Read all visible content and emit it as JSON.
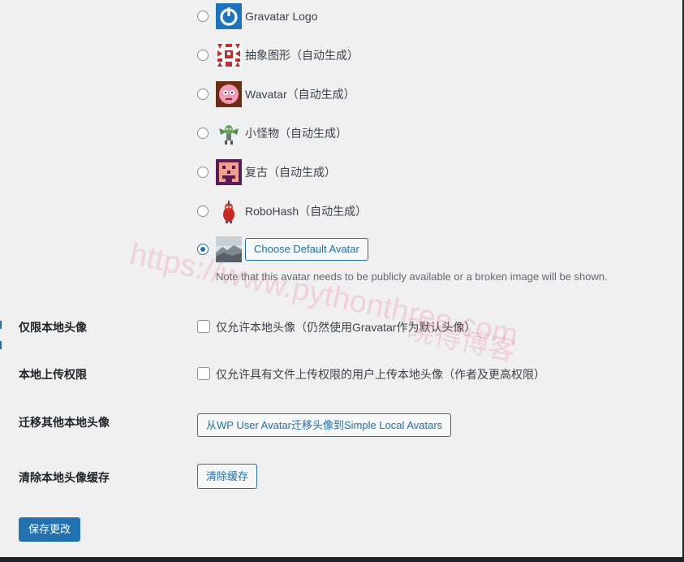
{
  "avatars": [
    {
      "label": "Gravatar Logo",
      "icon": "gravatar-logo-icon",
      "checked": false
    },
    {
      "label": "抽象图形（自动生成）",
      "icon": "identicon-icon",
      "checked": false
    },
    {
      "label": "Wavatar（自动生成）",
      "icon": "wavatar-icon",
      "checked": false
    },
    {
      "label": "小怪物（自动生成）",
      "icon": "monsterid-icon",
      "checked": false
    },
    {
      "label": "复古（自动生成）",
      "icon": "retro-icon",
      "checked": false
    },
    {
      "label": "RoboHash（自动生成）",
      "icon": "robohash-icon",
      "checked": false
    },
    {
      "label": "",
      "icon": "custom-default-avatar-icon",
      "checked": true
    }
  ],
  "choose_default_avatar": "Choose Default Avatar",
  "note": "Note that this avatar needs to be publicly available or a broken image will be shown.",
  "settings": {
    "local_only": {
      "label": "仅限本地头像",
      "checkbox_label": "仅允许本地头像（仍然使用Gravatar作为默认头像）",
      "checked": false
    },
    "upload_permission": {
      "label": "本地上传权限",
      "checkbox_label": "仅允许具有文件上传权限的用户上传本地头像（作者及更高权限）",
      "checked": false
    },
    "migrate": {
      "label": "迁移其他本地头像",
      "button": "从WP User Avatar迁移头像到Simple Local Avatars"
    },
    "clear_cache": {
      "label": "清除本地头像缓存",
      "button": "清除缓存"
    }
  },
  "save_button": "保存更改",
  "watermark": {
    "url": "https://www.pythonthree.com",
    "blog": "晓得博客"
  },
  "colors": {
    "primary": "#2271b1",
    "background": "#f0f0f1",
    "text": "#1d2327",
    "muted": "#646970"
  }
}
